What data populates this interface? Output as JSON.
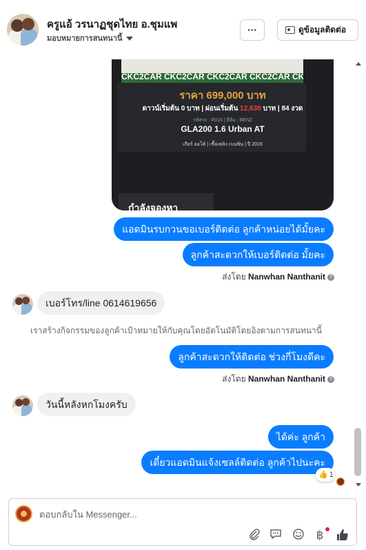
{
  "header": {
    "title": "ครูแอ้ วรนาฏชุดไทย อ.ชุมแพ",
    "subtitle": "มอบหมายการสนทนานี้",
    "more_label": "···",
    "contact_button_label": "ดูข้อมูลติดต่อ"
  },
  "image_card": {
    "banner_text": "CKC2CAR CKC2CAR CKC2CAR CKC2CAR CKC2",
    "price": "ราคา 699,000 บาท",
    "down_prefix": "ดาวน์เริ่มต้น 0 บาท | ผ่อนเริ่มต้น",
    "installment": "12,638",
    "down_suffix": "บาท | 84 งวด",
    "code_line": "รหัสรถ : R016 | ยี่ห้อ : BENZ",
    "model": "GLA200 1.6 Urban AT",
    "specs": "เกียร์ ออโต้  |  เชื้อเพลิง เบนซิน  |  ปี 2016",
    "bottom_text": "กำลังจองหา"
  },
  "messages": [
    {
      "text": "แอดมินรบกวนขอเบอร์ติดต่อ ลูกค้าหน่อยได้มั้ยคะ",
      "direction": "out"
    },
    {
      "text": "ลูกค้าสะดวกให้เบอร์ติดต่อ มั้ยคะ",
      "direction": "out"
    },
    {
      "text": "เบอร์โทร/line  0614619656",
      "direction": "in"
    },
    {
      "text": "ลูกค้าสะดวกให้ติดต่อ ช่วงกี่โมงดีคะ",
      "direction": "out"
    },
    {
      "text": "วันนี้หลังหกโมงครับ",
      "direction": "in"
    },
    {
      "text": "ได้ค่ะ ลูกค้า",
      "direction": "out"
    },
    {
      "text": "เดี๋ยวแอดมินแจ้งเซลล์ติดต่อ ลูกค้าไปนะคะ",
      "direction": "out"
    }
  ],
  "sent_by": {
    "prefix": "ส่งโดย",
    "name": "Nanwhan Nanthanit",
    "help": "?"
  },
  "system_note": "เราสร้างกิจกรรมของลูกค้าเป้าหมายให้กับคุณโดยอัตโนมัติโดยอิงตามการสนทนานี้",
  "reaction": {
    "icon": "👍",
    "count": "1"
  },
  "composer": {
    "placeholder": "ตอบกลับใน Messenger...",
    "tools": [
      "paperclip-icon",
      "chat-bubble-icon",
      "smiley-icon",
      "baht-icon",
      "thumbs-up-icon"
    ],
    "baht_symbol": "฿"
  }
}
